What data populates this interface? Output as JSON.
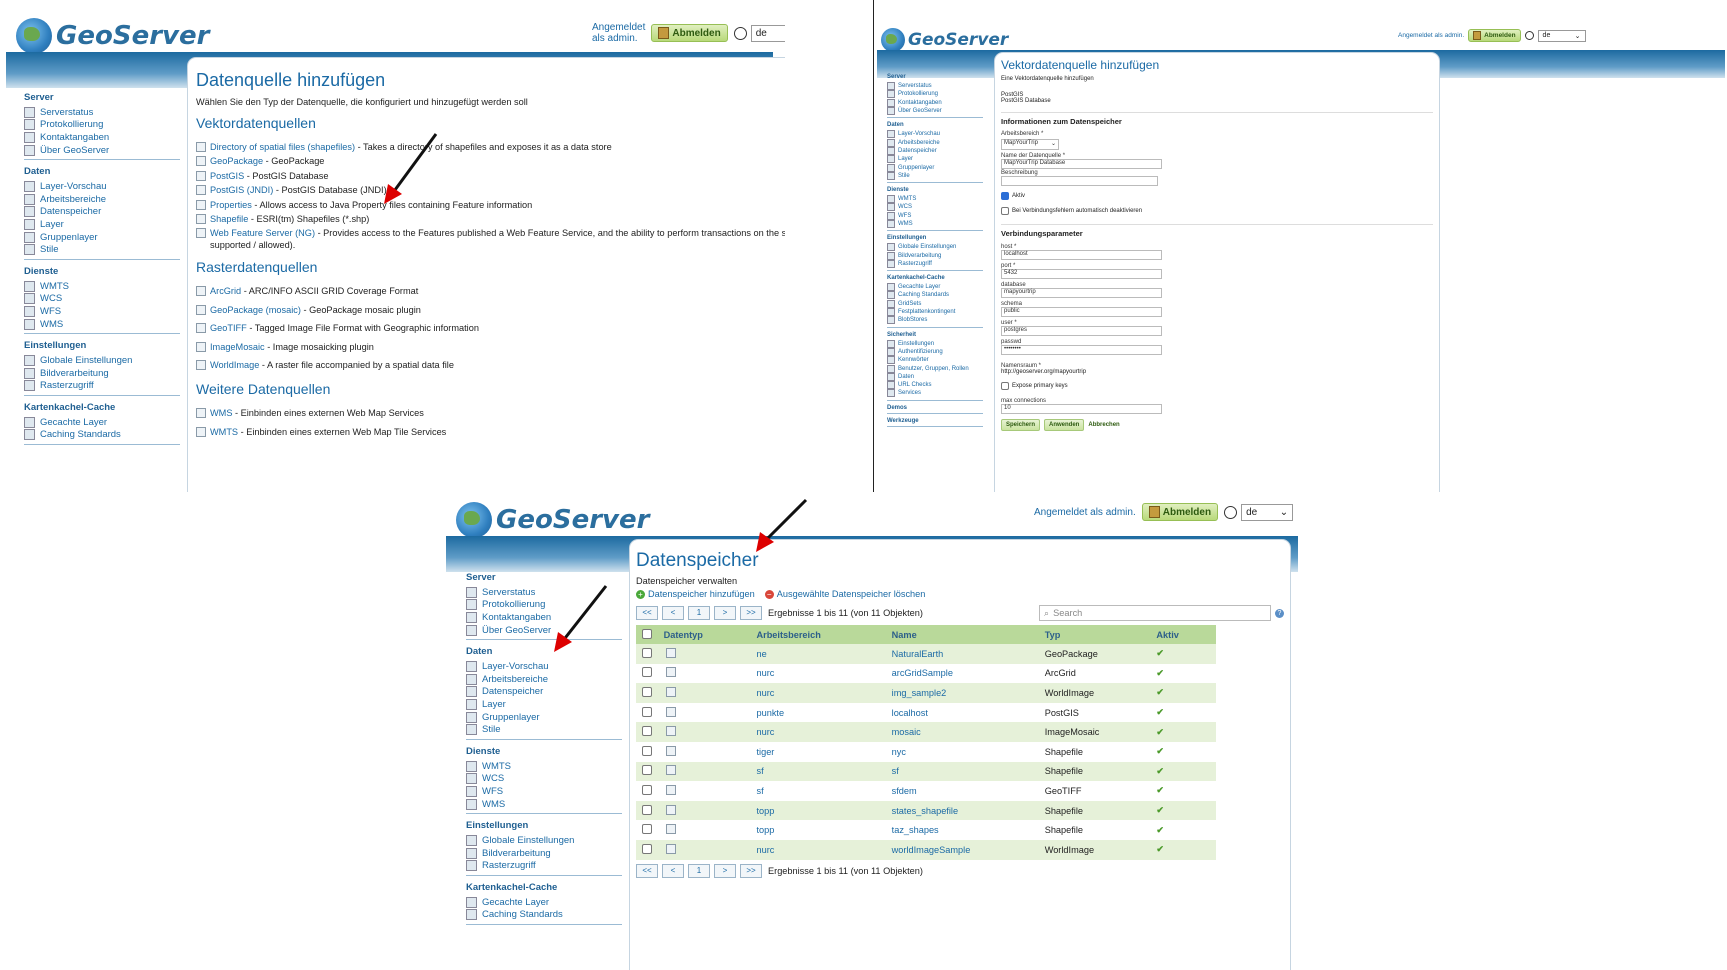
{
  "panel1": {
    "logo": "GeoServer",
    "login_text": "Angemeldet als admin.",
    "logout_label": "Abmelden",
    "lang": "de",
    "sidebar": [
      {
        "heading": "Server",
        "items": [
          "Serverstatus",
          "Protokollierung",
          "Kontaktangaben",
          "Über GeoServer"
        ]
      },
      {
        "heading": "Daten",
        "items": [
          "Layer-Vorschau",
          "Arbeitsbereiche",
          "Datenspeicher",
          "Layer",
          "Gruppenlayer",
          "Stile"
        ]
      },
      {
        "heading": "Dienste",
        "items": [
          "WMTS",
          "WCS",
          "WFS",
          "WMS"
        ]
      },
      {
        "heading": "Einstellungen",
        "items": [
          "Globale Einstellungen",
          "Bildverarbeitung",
          "Rasterzugriff"
        ]
      },
      {
        "heading": "Kartenkachel-Cache",
        "items": [
          "Gecachte Layer",
          "Caching Standards"
        ]
      }
    ],
    "title": "Datenquelle hinzufügen",
    "subtitle": "Wählen Sie den Typ der Datenquelle, die konfiguriert und hinzugefügt werden soll",
    "vector_heading": "Vektordatenquellen",
    "vector": [
      {
        "link": "Directory of spatial files (shapefiles)",
        "desc": " - Takes a directory of shapefiles and exposes it as a data store"
      },
      {
        "link": "GeoPackage",
        "desc": " - GeoPackage"
      },
      {
        "link": "PostGIS",
        "desc": " - PostGIS Database"
      },
      {
        "link": "PostGIS (JNDI)",
        "desc": " - PostGIS Database (JNDI)"
      },
      {
        "link": "Properties",
        "desc": " - Allows access to Java Property files containing Feature information"
      },
      {
        "link": "Shapefile",
        "desc": " - ESRI(tm) Shapefiles (*.shp)"
      },
      {
        "link": "Web Feature Server (NG)",
        "desc": " - Provides access to the Features published a Web Feature Service, and the ability to perform transactions on the server (when supported / allowed)."
      }
    ],
    "raster_heading": "Rasterdatenquellen",
    "raster": [
      {
        "link": "ArcGrid",
        "desc": " - ARC/INFO ASCII GRID Coverage Format"
      },
      {
        "link": "GeoPackage (mosaic)",
        "desc": " - GeoPackage mosaic plugin"
      },
      {
        "link": "GeoTIFF",
        "desc": " - Tagged Image File Format with Geographic information"
      },
      {
        "link": "ImageMosaic",
        "desc": " - Image mosaicking plugin"
      },
      {
        "link": "WorldImage",
        "desc": " - A raster file accompanied by a spatial data file"
      }
    ],
    "other_heading": "Weitere Datenquellen",
    "other": [
      {
        "link": "WMS",
        "desc": " - Einbinden eines externen Web Map Services"
      },
      {
        "link": "WMTS",
        "desc": " - Einbinden eines externen Web Map Tile Services"
      }
    ]
  },
  "panel2": {
    "logo": "GeoServer",
    "login_text": "Angemeldet als admin.",
    "logout_label": "Abmelden",
    "lang": "de",
    "sidebar": [
      {
        "heading": "Server",
        "items": [
          "Serverstatus",
          "Protokollierung",
          "Kontaktangaben",
          "Über GeoServer"
        ]
      },
      {
        "heading": "Daten",
        "items": [
          "Layer-Vorschau",
          "Arbeitsbereiche",
          "Datenspeicher",
          "Layer",
          "Gruppenlayer",
          "Stile"
        ]
      },
      {
        "heading": "Dienste",
        "items": [
          "WMTS",
          "WCS",
          "WFS",
          "WMS"
        ]
      },
      {
        "heading": "Einstellungen",
        "items": [
          "Globale Einstellungen",
          "Bildverarbeitung",
          "Rasterzugriff"
        ]
      },
      {
        "heading": "Kartenkachel-Cache",
        "items": [
          "Gecachte Layer",
          "Caching Standards",
          "GridSets",
          "Festplattenkontingent",
          "BlobStores"
        ]
      },
      {
        "heading": "Sicherheit",
        "items": [
          "Einstellungen",
          "Authentifizierung",
          "Kennwörter",
          "Benutzer, Gruppen, Rollen",
          "Daten",
          "URL Checks",
          "Services"
        ]
      },
      {
        "heading": "Demos",
        "items": []
      },
      {
        "heading": "Werkzeuge",
        "items": []
      }
    ],
    "title": "Vektordatenquelle hinzufügen",
    "subtitle": "Eine Vektordatenquelle hinzufügen",
    "source_type": "PostGIS",
    "source_desc": "PostGIS Database",
    "section_store": "Informationen zum Datenspeicher",
    "workspace_label": "Arbeitsbereich *",
    "workspace_value": "MapYourTrip",
    "name_label": "Name der Datenquelle *",
    "name_value": "MapYourTrip Database",
    "desc_label": "Beschreibung",
    "desc_value": "",
    "enabled_label": "Aktiv",
    "auto_disable_label": "Bei Verbindungsfehlern automatisch deaktivieren",
    "section_conn": "Verbindungsparameter",
    "params": [
      {
        "label": "host *",
        "value": "localhost"
      },
      {
        "label": "port *",
        "value": "5432"
      },
      {
        "label": "database",
        "value": "mapyourtrip"
      },
      {
        "label": "schema",
        "value": "public"
      },
      {
        "label": "user *",
        "value": "postgres"
      },
      {
        "label": "passwd",
        "value": "••••••••"
      }
    ],
    "namespace_label": "Namensraum *",
    "namespace_value": "http://geoserver.org/mapyourtrip",
    "expose_label": "Expose primary keys",
    "maxconn_label": "max connections",
    "maxconn_value": "10",
    "save": "Speichern",
    "apply": "Anwenden",
    "cancel": "Abbrechen"
  },
  "panel3": {
    "logo": "GeoServer",
    "login_text": "Angemeldet als admin.",
    "logout_label": "Abmelden",
    "lang": "de",
    "sidebar": [
      {
        "heading": "Server",
        "items": [
          "Serverstatus",
          "Protokollierung",
          "Kontaktangaben",
          "Über GeoServer"
        ]
      },
      {
        "heading": "Daten",
        "items": [
          "Layer-Vorschau",
          "Arbeitsbereiche",
          "Datenspeicher",
          "Layer",
          "Gruppenlayer",
          "Stile"
        ]
      },
      {
        "heading": "Dienste",
        "items": [
          "WMTS",
          "WCS",
          "WFS",
          "WMS"
        ]
      },
      {
        "heading": "Einstellungen",
        "items": [
          "Globale Einstellungen",
          "Bildverarbeitung",
          "Rasterzugriff"
        ]
      },
      {
        "heading": "Kartenkachel-Cache",
        "items": [
          "Gecachte Layer",
          "Caching Standards"
        ]
      }
    ],
    "title": "Datenspeicher",
    "subtitle": "Datenspeicher verwalten",
    "add_label": "Datenspeicher hinzufügen",
    "remove_label": "Ausgewählte Datenspeicher löschen",
    "pager": [
      "<<",
      "<",
      "1",
      ">",
      ">>"
    ],
    "results": "Ergebnisse 1 bis 11 (von 11 Objekten)",
    "search_placeholder": "Search",
    "columns": [
      "Datentyp",
      "Arbeitsbereich",
      "Name",
      "Typ",
      "Aktiv"
    ],
    "rows": [
      {
        "ws": "ne",
        "name": "NaturalEarth",
        "type": "GeoPackage",
        "active": "✔"
      },
      {
        "ws": "nurc",
        "name": "arcGridSample",
        "type": "ArcGrid",
        "active": "✔"
      },
      {
        "ws": "nurc",
        "name": "img_sample2",
        "type": "WorldImage",
        "active": "✔"
      },
      {
        "ws": "punkte",
        "name": "localhost",
        "type": "PostGIS",
        "active": "✔"
      },
      {
        "ws": "nurc",
        "name": "mosaic",
        "type": "ImageMosaic",
        "active": "✔"
      },
      {
        "ws": "tiger",
        "name": "nyc",
        "type": "Shapefile",
        "active": "✔"
      },
      {
        "ws": "sf",
        "name": "sf",
        "type": "Shapefile",
        "active": "✔"
      },
      {
        "ws": "sf",
        "name": "sfdem",
        "type": "GeoTIFF",
        "active": "✔"
      },
      {
        "ws": "topp",
        "name": "states_shapefile",
        "type": "Shapefile",
        "active": "✔"
      },
      {
        "ws": "topp",
        "name": "taz_shapes",
        "type": "Shapefile",
        "active": "✔"
      },
      {
        "ws": "nurc",
        "name": "worldImageSample",
        "type": "WorldImage",
        "active": "✔"
      }
    ]
  }
}
